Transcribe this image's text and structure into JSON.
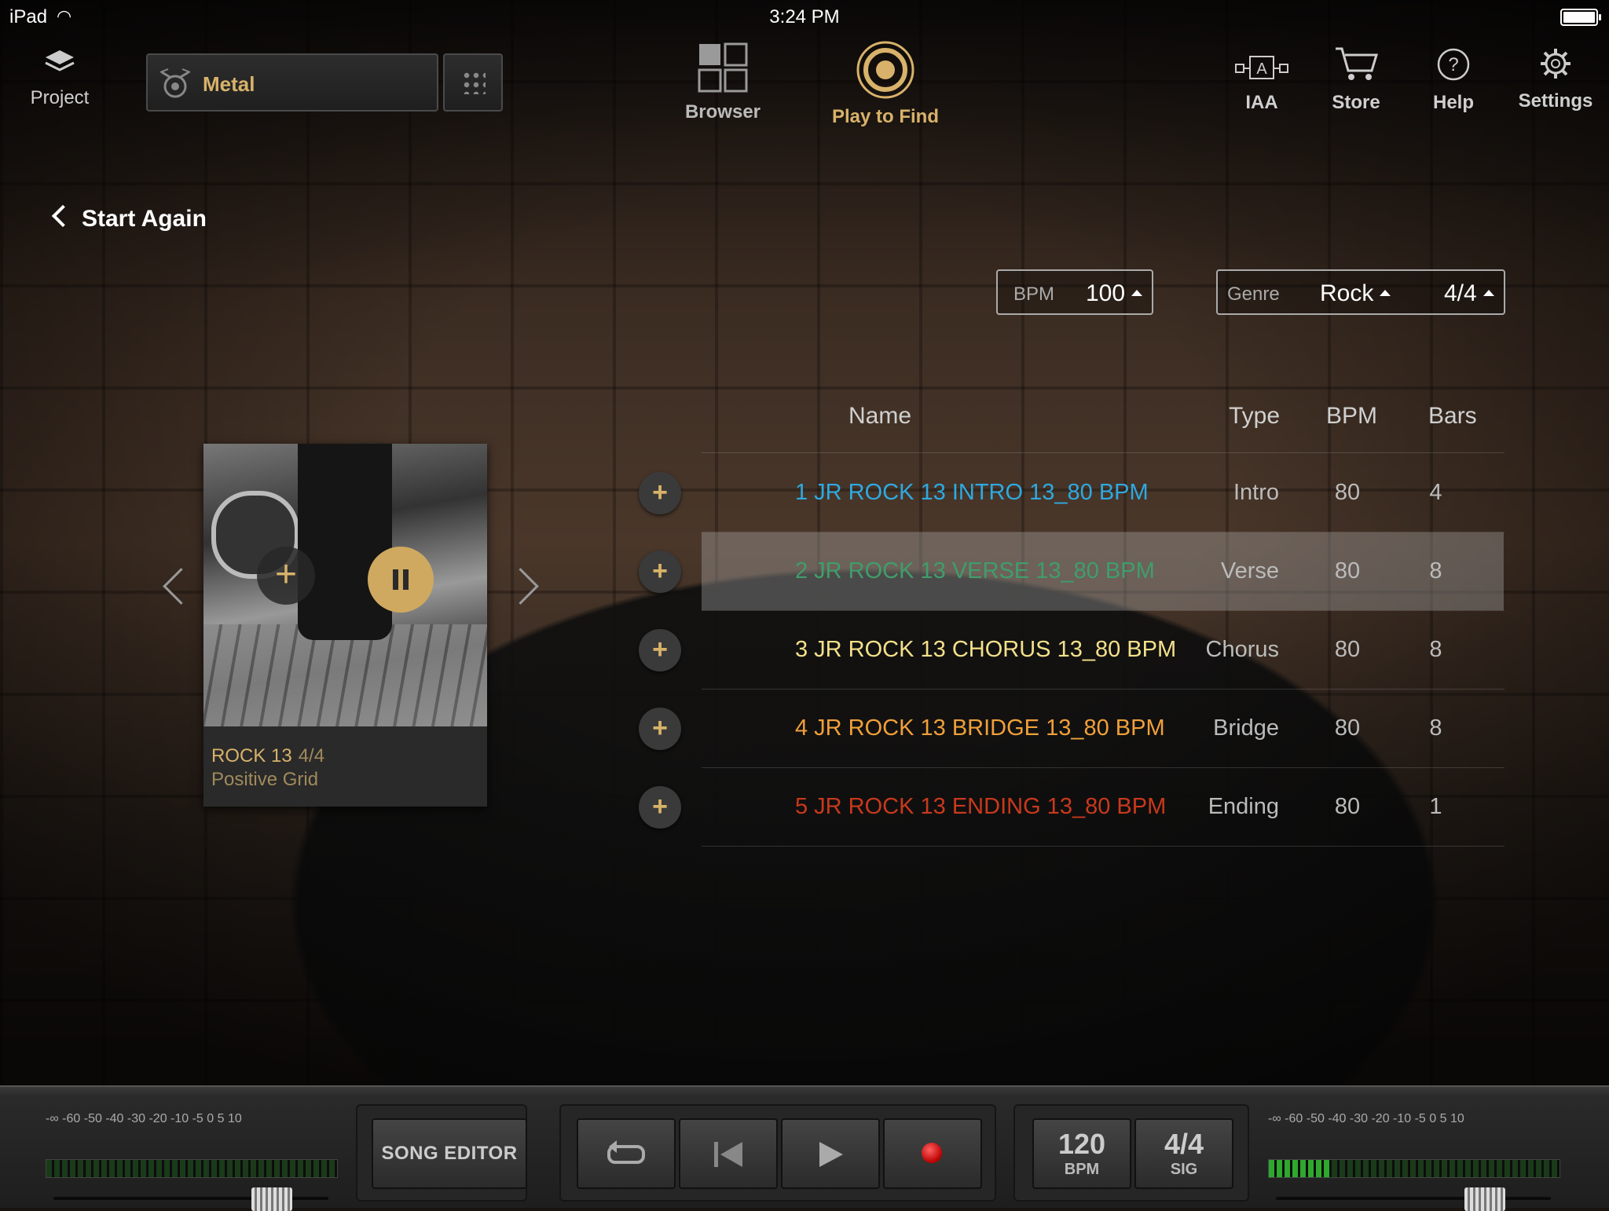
{
  "status_bar": {
    "device": "iPad",
    "time": "3:24 PM"
  },
  "toolbar": {
    "project_label": "Project",
    "preset_name": "Metal",
    "browser_label": "Browser",
    "play_to_find_label": "Play to Find",
    "iaa_label": "IAA",
    "store_label": "Store",
    "help_label": "Help",
    "settings_label": "Settings"
  },
  "nav": {
    "start_again": "Start Again"
  },
  "filters": {
    "bpm_key": "BPM",
    "bpm_value": "100",
    "genre_key": "Genre",
    "genre_value": "Rock",
    "sig_value": "4/4"
  },
  "table": {
    "headers": {
      "name": "Name",
      "type": "Type",
      "bpm": "BPM",
      "bars": "Bars"
    },
    "rows": [
      {
        "name": "1 JR ROCK 13 INTRO 13_80 BPM",
        "type": "Intro",
        "bpm": "80",
        "bars": "4",
        "color": "#2fa9e0"
      },
      {
        "name": "2 JR ROCK 13 VERSE 13_80 BPM",
        "type": "Verse",
        "bpm": "80",
        "bars": "8",
        "color": "#3f9e6a"
      },
      {
        "name": "3 JR ROCK 13 CHORUS 13_80 BPM",
        "type": "Chorus",
        "bpm": "80",
        "bars": "8",
        "color": "#f3e08a"
      },
      {
        "name": "4 JR ROCK 13 BRIDGE 13_80 BPM",
        "type": "Bridge",
        "bpm": "80",
        "bars": "8",
        "color": "#f0a03a"
      },
      {
        "name": "5 JR ROCK 13 ENDING 13_80 BPM",
        "type": "Ending",
        "bpm": "80",
        "bars": "1",
        "color": "#c8391c"
      }
    ],
    "selected_row": 2
  },
  "card": {
    "title": "ROCK 13",
    "signature": "4/4",
    "artist": "Positive Grid"
  },
  "bottom": {
    "meter_scale": "-∞  -60  -50  -40  -30  -20  -10   -5    0    5   10",
    "song_editor": "SONG EDITOR",
    "bpm_value": "120",
    "bpm_label": "BPM",
    "sig_value": "4/4",
    "sig_label": "SIG",
    "left_meter_level": 0,
    "right_meter_level": 0.16
  },
  "colors": {
    "accent_gold": "#d8b26a"
  }
}
